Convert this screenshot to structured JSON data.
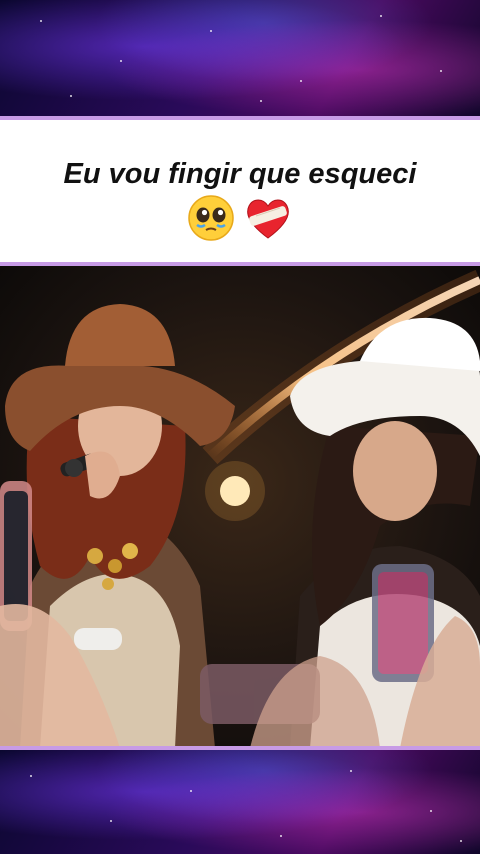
{
  "caption": {
    "text": "Eu vou fingir que esqueci",
    "emojis": [
      "pleading-face-emoji",
      "mending-heart-emoji"
    ]
  },
  "colors": {
    "accent_line": "#c79be6",
    "caption_bg": "#ffffff",
    "caption_text": "#111111"
  },
  "video": {
    "scene": "two singers in cowboy hats performing on stage"
  }
}
